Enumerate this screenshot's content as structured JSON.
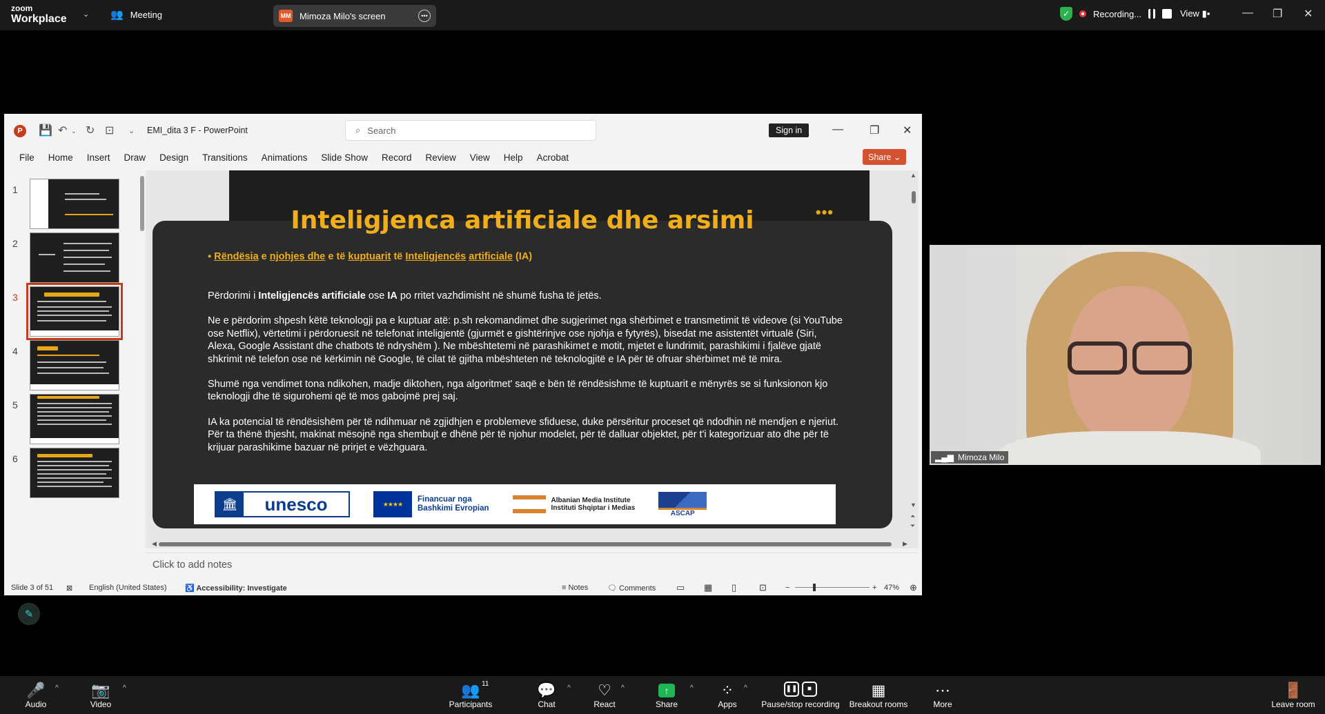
{
  "zoom": {
    "logo_line1": "zoom",
    "logo_line2": "Workplace",
    "meeting_label": "Meeting",
    "screen_avatar": "MM",
    "screen_label": "Mimoza Milo's screen",
    "recording_label": "Recording...",
    "view_label": "View",
    "shield_color": "#2bb24c"
  },
  "ppt": {
    "doc_title": "EMI_dita 3 F  -  PowerPoint",
    "search_placeholder": "Search",
    "signin_label": "Sign in",
    "share_label": "Share",
    "menu": [
      "File",
      "Home",
      "Insert",
      "Draw",
      "Design",
      "Transitions",
      "Animations",
      "Slide Show",
      "Record",
      "Review",
      "View",
      "Help",
      "Acrobat"
    ],
    "thumb_numbers": [
      "1",
      "2",
      "3",
      "4",
      "5",
      "6"
    ],
    "active_slide": 3,
    "slide": {
      "title": "Inteligjenca artificiale dhe arsimi",
      "dots": "•••",
      "bullet_parts": [
        "Rëndësia",
        " e ",
        "njohjes dhe",
        " e të ",
        "kuptuarit",
        " të ",
        "Inteligjencës",
        " ",
        "artificiale",
        " (IA)"
      ],
      "p1_a": "Përdorimi i ",
      "p1_b": "Inteligjencës artificiale",
      "p1_c": " ose ",
      "p1_d": "IA",
      "p1_e": " po rritet vazhdimisht në shumë fusha të jetës.",
      "p2": "Ne e përdorim shpesh këtë teknologji pa e kuptuar atë: p.sh rekomandimet dhe sugjerimet nga shërbimet e transmetimit të videove (si YouTube ose Netflix), vërtetimi i përdoruesit në telefonat inteligjentë (gjurmët e gishtërinjve ose njohja e fytyrës), bisedat me asistentët virtualë (Siri, Alexa, Google Assistant dhe chatbots të ndryshëm ). Ne mbështetemi në parashikimet e motit, mjetet e lundrimit, parashikimi i fjalëve gjatë shkrimit në telefon ose në kërkimin në Google, të cilat të gjitha mbështeten në teknologjitë e IA për të ofruar shërbimet më të mira.",
      "p3": "Shumë nga vendimet tona ndikohen, madje diktohen, nga algoritmet' saqë e bën të rëndësishme të kuptuarit  e mënyrës se si funksionon kjo teknologji dhe të sigurohemi që të mos gabojmë prej saj.",
      "p4": "IA ka potencial të rëndësishëm për të ndihmuar në zgjidhjen e problemeve sfiduese, duke përsëritur proceset që ndodhin në mendjen e njeriut. Për ta thënë thjesht, makinat mësojnë nga shembujt e dhënë për të njohur modelet, për të dalluar objektet, për t'i kategorizuar ato dhe për të krijuar parashikime bazuar në prirjet e vëzhguara.",
      "logo_unesco": "unesco",
      "logo_eu_line1": "Financuar nga",
      "logo_eu_line2": "Bashkimi Evropian",
      "logo_ami_line1": "Albanian Media Institute",
      "logo_ami_line2": "Instituti Shqiptar i Medias",
      "logo_ascap": "ASCAP"
    },
    "notes_placeholder": "Click to add notes",
    "status": {
      "slide_of": "Slide 3 of 51",
      "language": "English (United States)",
      "accessibility": "Accessibility: Investigate",
      "notes": "Notes",
      "comments": "Comments",
      "zoom": "47%"
    }
  },
  "video": {
    "participant_name": "Mimoza Milo"
  },
  "toolbar": {
    "audio": "Audio",
    "video": "Video",
    "participants": "Participants",
    "participants_count": "11",
    "chat": "Chat",
    "react": "React",
    "share": "Share",
    "apps": "Apps",
    "pause_stop": "Pause/stop recording",
    "breakout": "Breakout rooms",
    "more": "More",
    "leave": "Leave room"
  }
}
